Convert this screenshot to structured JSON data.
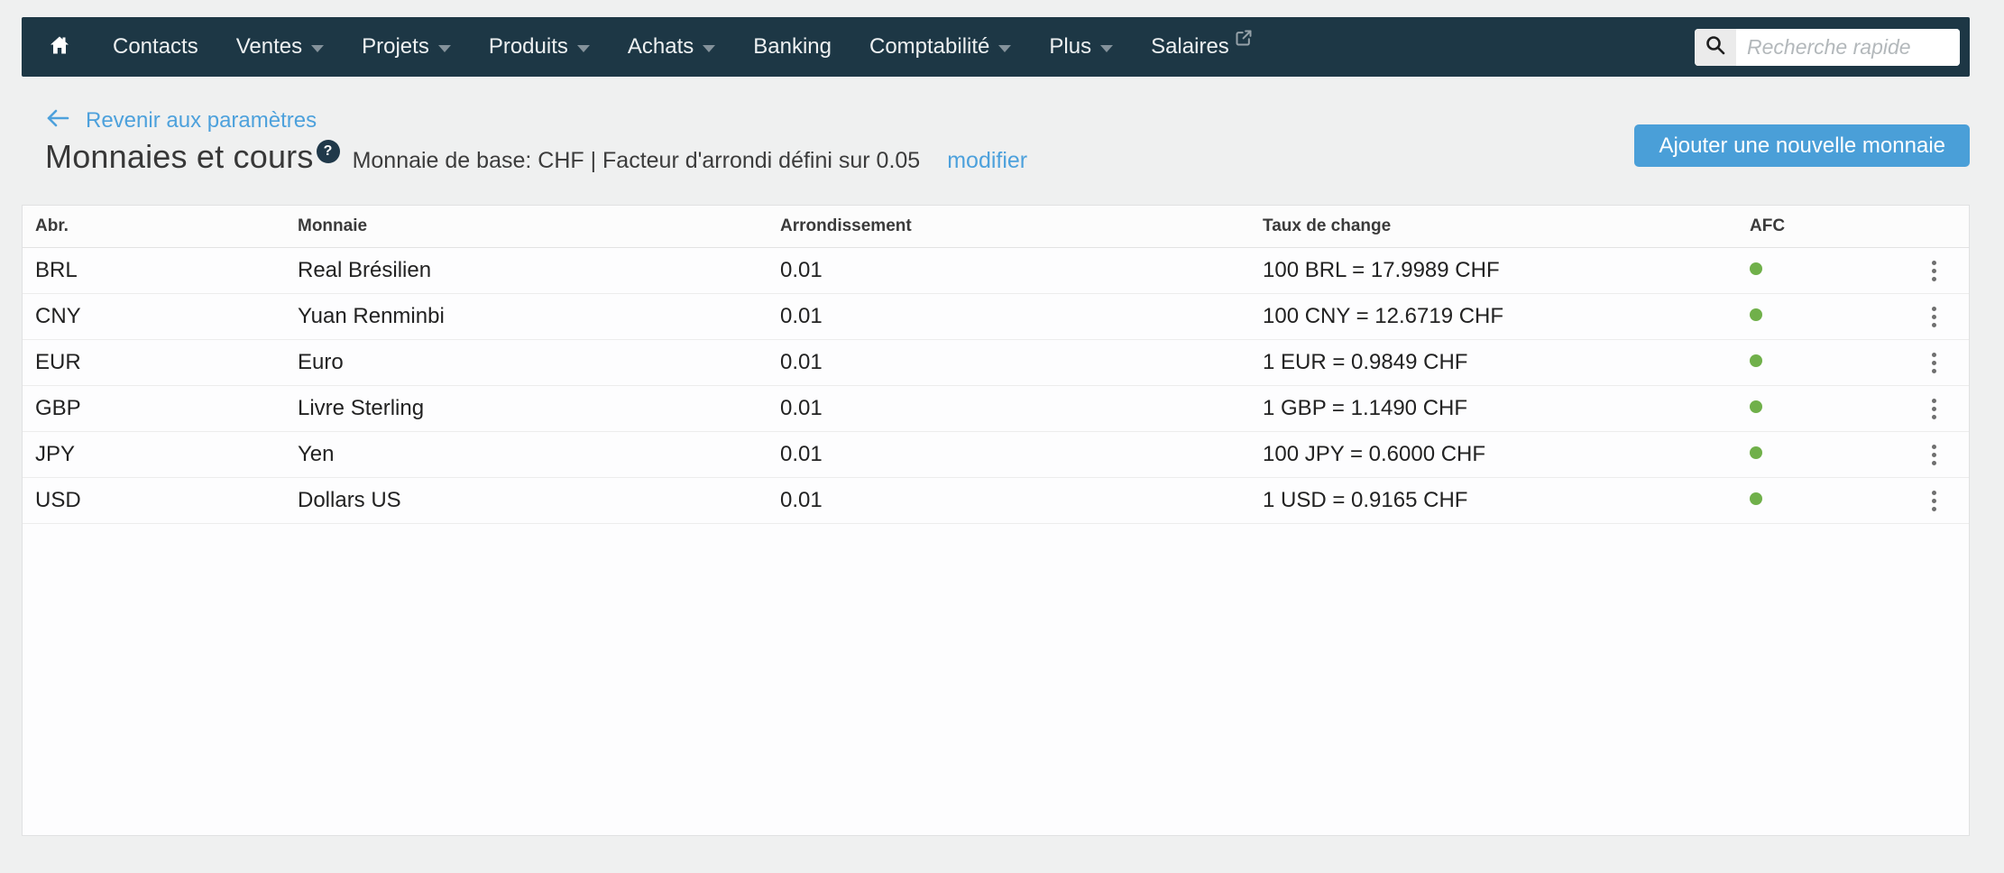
{
  "nav": {
    "items": [
      {
        "label": "Contacts",
        "caret": false
      },
      {
        "label": "Ventes",
        "caret": true
      },
      {
        "label": "Projets",
        "caret": true
      },
      {
        "label": "Produits",
        "caret": true
      },
      {
        "label": "Achats",
        "caret": true
      },
      {
        "label": "Banking",
        "caret": false
      },
      {
        "label": "Comptabilité",
        "caret": true
      },
      {
        "label": "Plus",
        "caret": true
      },
      {
        "label": "Salaires",
        "caret": false,
        "external": true
      }
    ],
    "search": {
      "placeholder": "Recherche rapide"
    }
  },
  "header": {
    "back_label": "Revenir aux paramètres",
    "title": "Monnaies et cours",
    "help_badge": "?",
    "subtitle": "Monnaie de base: CHF | Facteur d'arrondi défini sur 0.05",
    "edit_link": "modifier",
    "add_button": "Ajouter une nouvelle monnaie"
  },
  "table": {
    "columns": [
      "Abr.",
      "Monnaie",
      "Arrondissement",
      "Taux de change",
      "AFC"
    ],
    "rows": [
      {
        "abr": "BRL",
        "name": "Real Brésilien",
        "rounding": "0.01",
        "rate": "100 BRL = 17.9989 CHF",
        "afc_active": true
      },
      {
        "abr": "CNY",
        "name": "Yuan Renminbi",
        "rounding": "0.01",
        "rate": "100 CNY = 12.6719 CHF",
        "afc_active": true
      },
      {
        "abr": "EUR",
        "name": "Euro",
        "rounding": "0.01",
        "rate": "1 EUR = 0.9849 CHF",
        "afc_active": true
      },
      {
        "abr": "GBP",
        "name": "Livre Sterling",
        "rounding": "0.01",
        "rate": "1 GBP = 1.1490 CHF",
        "afc_active": true
      },
      {
        "abr": "JPY",
        "name": "Yen",
        "rounding": "0.01",
        "rate": "100 JPY = 0.6000 CHF",
        "afc_active": true
      },
      {
        "abr": "USD",
        "name": "Dollars US",
        "rounding": "0.01",
        "rate": "1 USD = 0.9165 CHF",
        "afc_active": true
      }
    ]
  },
  "colors": {
    "navbar_bg": "#1d3745",
    "accent_blue": "#4a9fd8",
    "link_blue": "#4da1dc",
    "status_green": "#70b04a",
    "page_bg": "#eff0f0"
  }
}
